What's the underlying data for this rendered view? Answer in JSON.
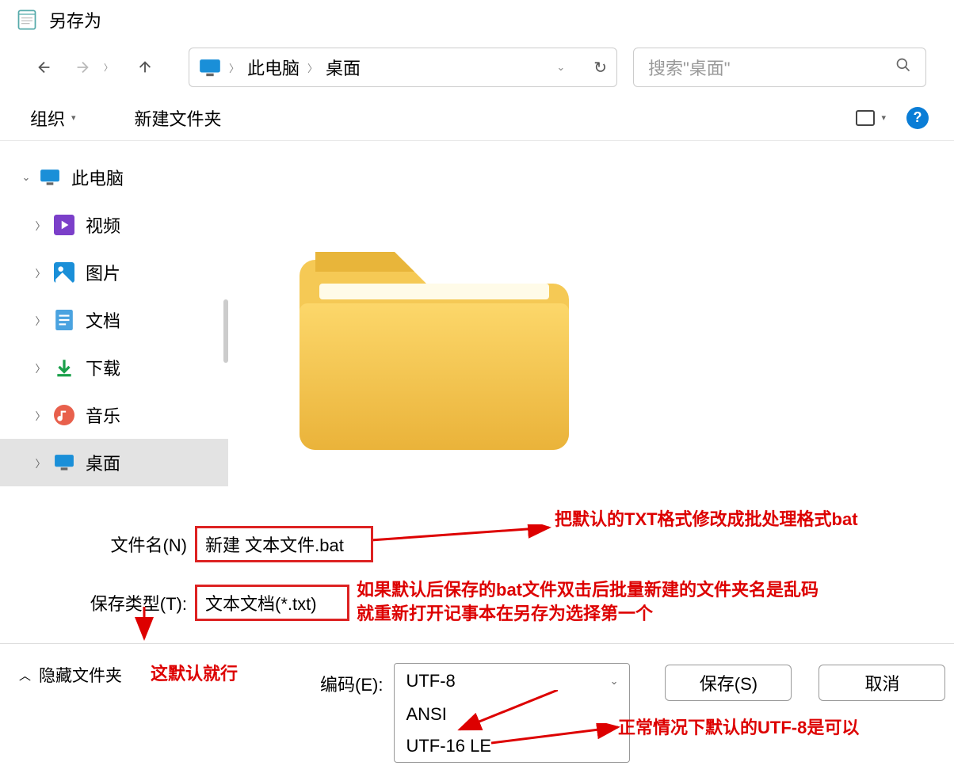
{
  "title": "另存为",
  "breadcrumb": {
    "pc": "此电脑",
    "desktop": "桌面"
  },
  "search_placeholder": "搜索\"桌面\"",
  "toolbar": {
    "organize": "组织",
    "new_folder": "新建文件夹"
  },
  "sidebar": {
    "pc": "此电脑",
    "items": [
      {
        "label": "视频"
      },
      {
        "label": "图片"
      },
      {
        "label": "文档"
      },
      {
        "label": "下载"
      },
      {
        "label": "音乐"
      },
      {
        "label": "桌面"
      }
    ]
  },
  "form": {
    "filename_label": "文件名(N)",
    "filename_value": "新建 文本文件.bat",
    "filetype_label": "保存类型(T):",
    "filetype_value": "文本文档(*.txt)"
  },
  "footer": {
    "hide_folders": "隐藏文件夹",
    "encoding_label": "编码(E):",
    "encoding_selected": "UTF-8",
    "encoding_options": [
      "ANSI",
      "UTF-16 LE"
    ],
    "save": "保存(S)",
    "cancel": "取消"
  },
  "annotations": {
    "top": "把默认的TXT格式修改成批处理格式bat",
    "mid1": "如果默认后保存的bat文件双击后批量新建的文件夹名是乱码",
    "mid2": "就重新打开记事本在另存为选择第一个",
    "left": "这默认就行",
    "bottom": "正常情况下默认的UTF-8是可以"
  }
}
